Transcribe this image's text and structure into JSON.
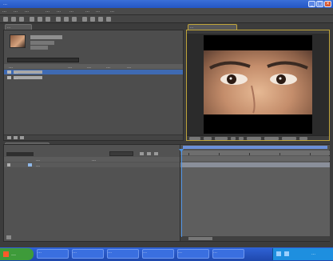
{
  "window": {
    "title": "…",
    "controls": {
      "minimize": "_",
      "maximize": "□",
      "close": "×"
    }
  },
  "menu": {
    "items": [
      "…",
      "…",
      "…",
      "…",
      "…",
      "…",
      "…",
      "…",
      "…"
    ]
  },
  "toolbar": {
    "icons": [
      "selection-tool-icon",
      "hand-tool-icon",
      "zoom-tool-icon",
      "rotate-tool-icon",
      "camera-tool-icon",
      "pan-behind-tool-icon",
      "rectangle-tool-icon",
      "pen-tool-icon",
      "text-tool-icon",
      "brush-tool-icon",
      "clone-stamp-tool-icon",
      "eraser-tool-icon",
      "puppet-tool-icon"
    ]
  },
  "project_panel": {
    "tab": "…",
    "columns": [
      "…",
      "…",
      "…",
      "…",
      "…"
    ],
    "items": [
      {
        "name": "…"
      },
      {
        "name": "…"
      }
    ]
  },
  "composition_panel": {
    "tab": "…",
    "viewer_image": "close-up of a person's eyes on a black letterboxed frame"
  },
  "timeline_panel": {
    "tab": "…",
    "columns": [
      "…",
      "…"
    ],
    "layers": [
      {
        "name": "…"
      }
    ]
  },
  "taskbar": {
    "start_label": "…",
    "tasks": [
      "…",
      "…",
      "…",
      "…",
      "…",
      "…"
    ],
    "clock": "…"
  },
  "colors": {
    "panel_bg": "#4d4d4d",
    "viewer_border": "#bfa43a",
    "timeline_marker": "#4a8fe0",
    "taskbar_blue": "#245edc",
    "start_green": "#3e9b3a"
  }
}
